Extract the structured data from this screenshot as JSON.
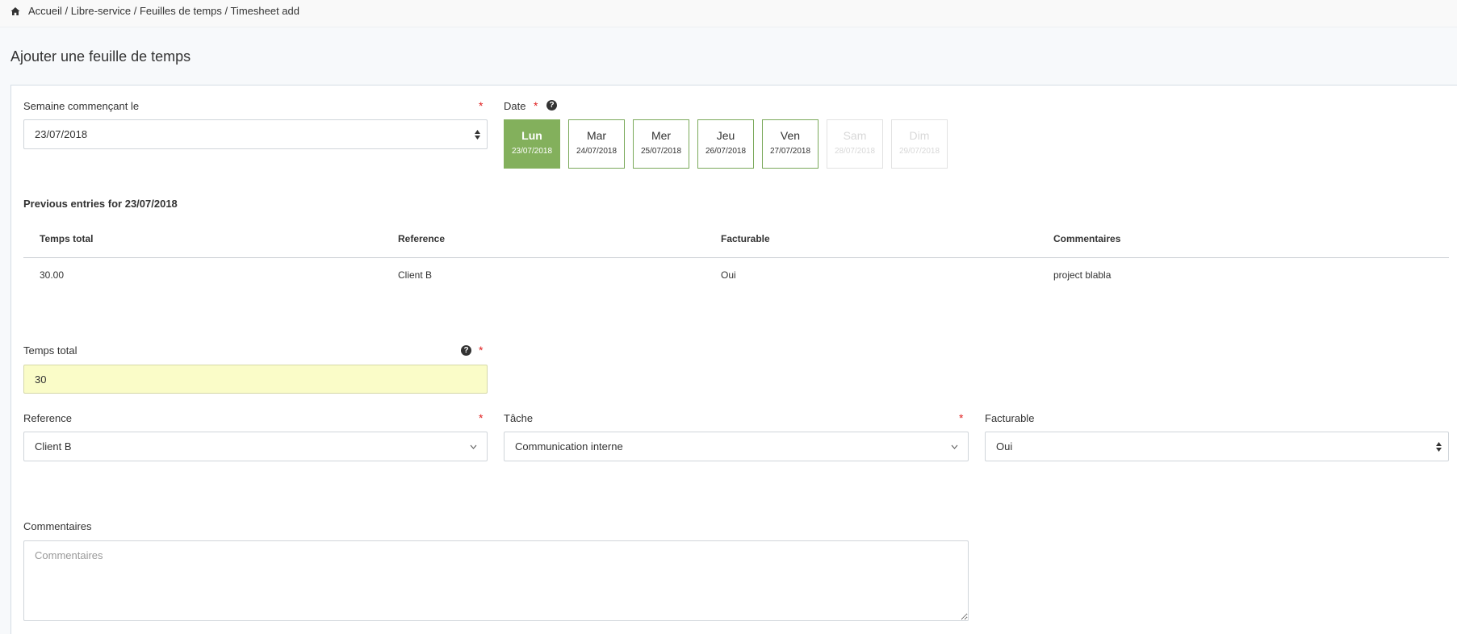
{
  "breadcrumb": {
    "text": "Accueil / Libre-service / Feuilles de temps / Timesheet add"
  },
  "page_title": "Ajouter une feuille de temps",
  "week": {
    "label": "Semaine commençant le",
    "required": "*",
    "value": "23/07/2018"
  },
  "date": {
    "label": "Date",
    "required": "*",
    "help": "?",
    "days": [
      {
        "name": "Lun",
        "date": "23/07/2018",
        "state": "active"
      },
      {
        "name": "Mar",
        "date": "24/07/2018",
        "state": "enabled"
      },
      {
        "name": "Mer",
        "date": "25/07/2018",
        "state": "enabled"
      },
      {
        "name": "Jeu",
        "date": "26/07/2018",
        "state": "enabled"
      },
      {
        "name": "Ven",
        "date": "27/07/2018",
        "state": "enabled"
      },
      {
        "name": "Sam",
        "date": "28/07/2018",
        "state": "disabled"
      },
      {
        "name": "Dim",
        "date": "29/07/2018",
        "state": "disabled"
      }
    ]
  },
  "previous": {
    "title": "Previous entries for 23/07/2018",
    "columns": [
      "Temps total",
      "Reference",
      "Facturable",
      "Commentaires"
    ],
    "rows": [
      [
        "30.00",
        "Client B",
        "Oui",
        "project blabla"
      ]
    ]
  },
  "total_time": {
    "label": "Temps total",
    "help": "?",
    "required": "*",
    "value": "30"
  },
  "reference": {
    "label": "Reference",
    "required": "*",
    "value": "Client B"
  },
  "task": {
    "label": "Tâche",
    "required": "*",
    "value": "Communication interne"
  },
  "billable": {
    "label": "Facturable",
    "value": "Oui"
  },
  "comments": {
    "label": "Commentaires",
    "placeholder": "Commentaires"
  },
  "colors": {
    "accent": "#83b05c",
    "required": "#e02020",
    "highlight_field": "#fafcc8"
  }
}
